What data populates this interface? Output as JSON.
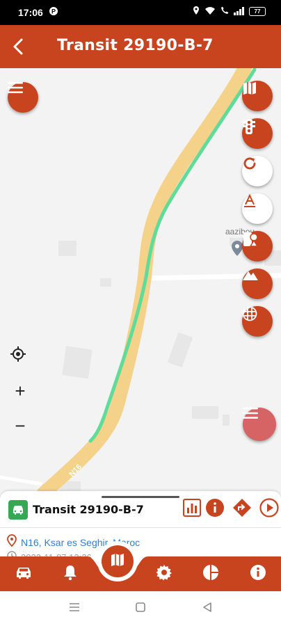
{
  "status_bar": {
    "time": "17:06",
    "battery": "77"
  },
  "header": {
    "title": "Transit 29190-B-7"
  },
  "map": {
    "place_label": "aazibou",
    "road_label": "N16",
    "zoom_in": "+",
    "zoom_out": "−",
    "colors": {
      "route": "#5fdc9a",
      "road": "#f7d58b",
      "accent": "#c8441f"
    }
  },
  "sheet": {
    "vehicle_name": "Transit 29190-B-7",
    "location": "N16, Ksar es Seghir, Maroc",
    "timestamp": "2022-11-07 12:36"
  },
  "nav": {
    "items": [
      "car-icon",
      "bell-icon",
      "map-icon",
      "gear-icon",
      "pie-chart-icon",
      "info-icon"
    ]
  }
}
